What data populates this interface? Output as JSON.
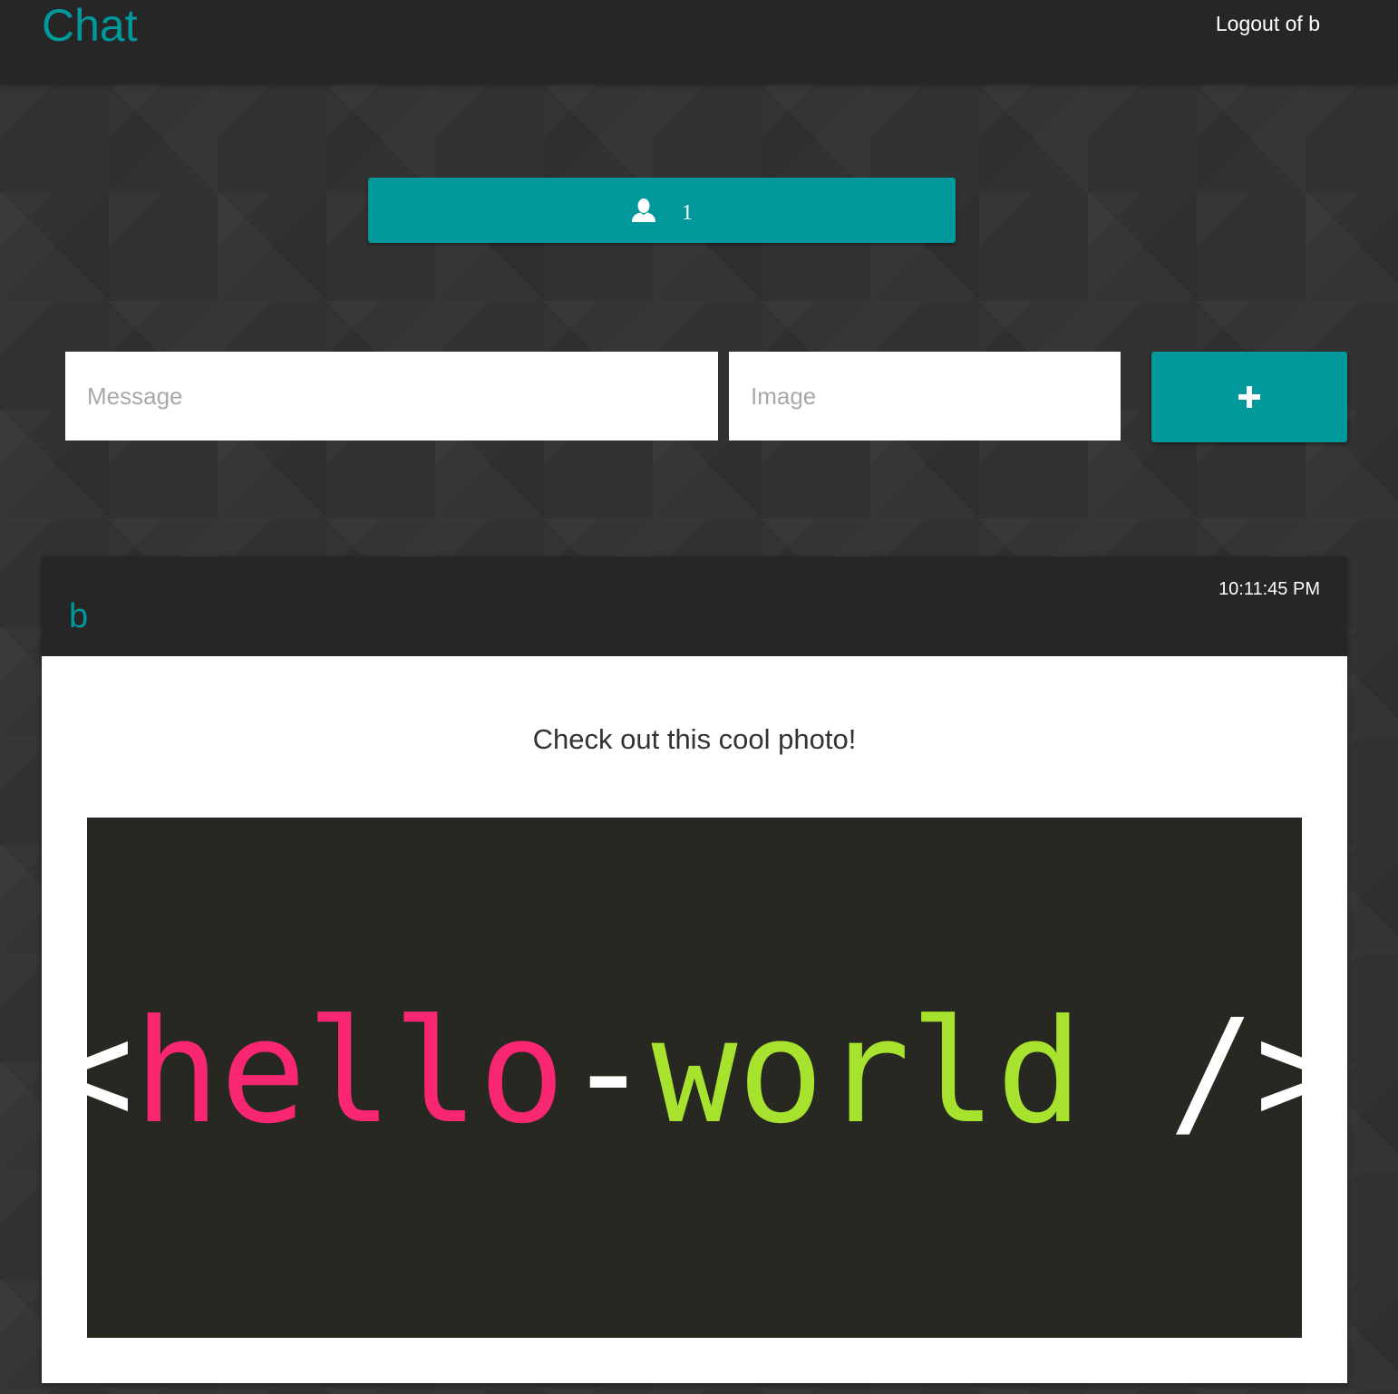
{
  "header": {
    "brand": "Chat",
    "logout_label": "Logout of b"
  },
  "online_users": {
    "icon": "user-icon",
    "count": "1"
  },
  "composer": {
    "message_placeholder": "Message",
    "image_placeholder": "Image",
    "submit_icon": "plus-icon"
  },
  "messages": [
    {
      "author": "b",
      "time": "10:11:45 PM",
      "text": "Check out this cool photo!",
      "image": {
        "open_bracket": "<",
        "word1": "hello",
        "dash": "-",
        "word2": "world",
        "close": " />"
      }
    }
  ],
  "colors": {
    "accent": "#00989a",
    "header_bg": "#262626",
    "image_bg": "#272822",
    "image_pink": "#f92672",
    "image_green": "#a6e22e"
  }
}
